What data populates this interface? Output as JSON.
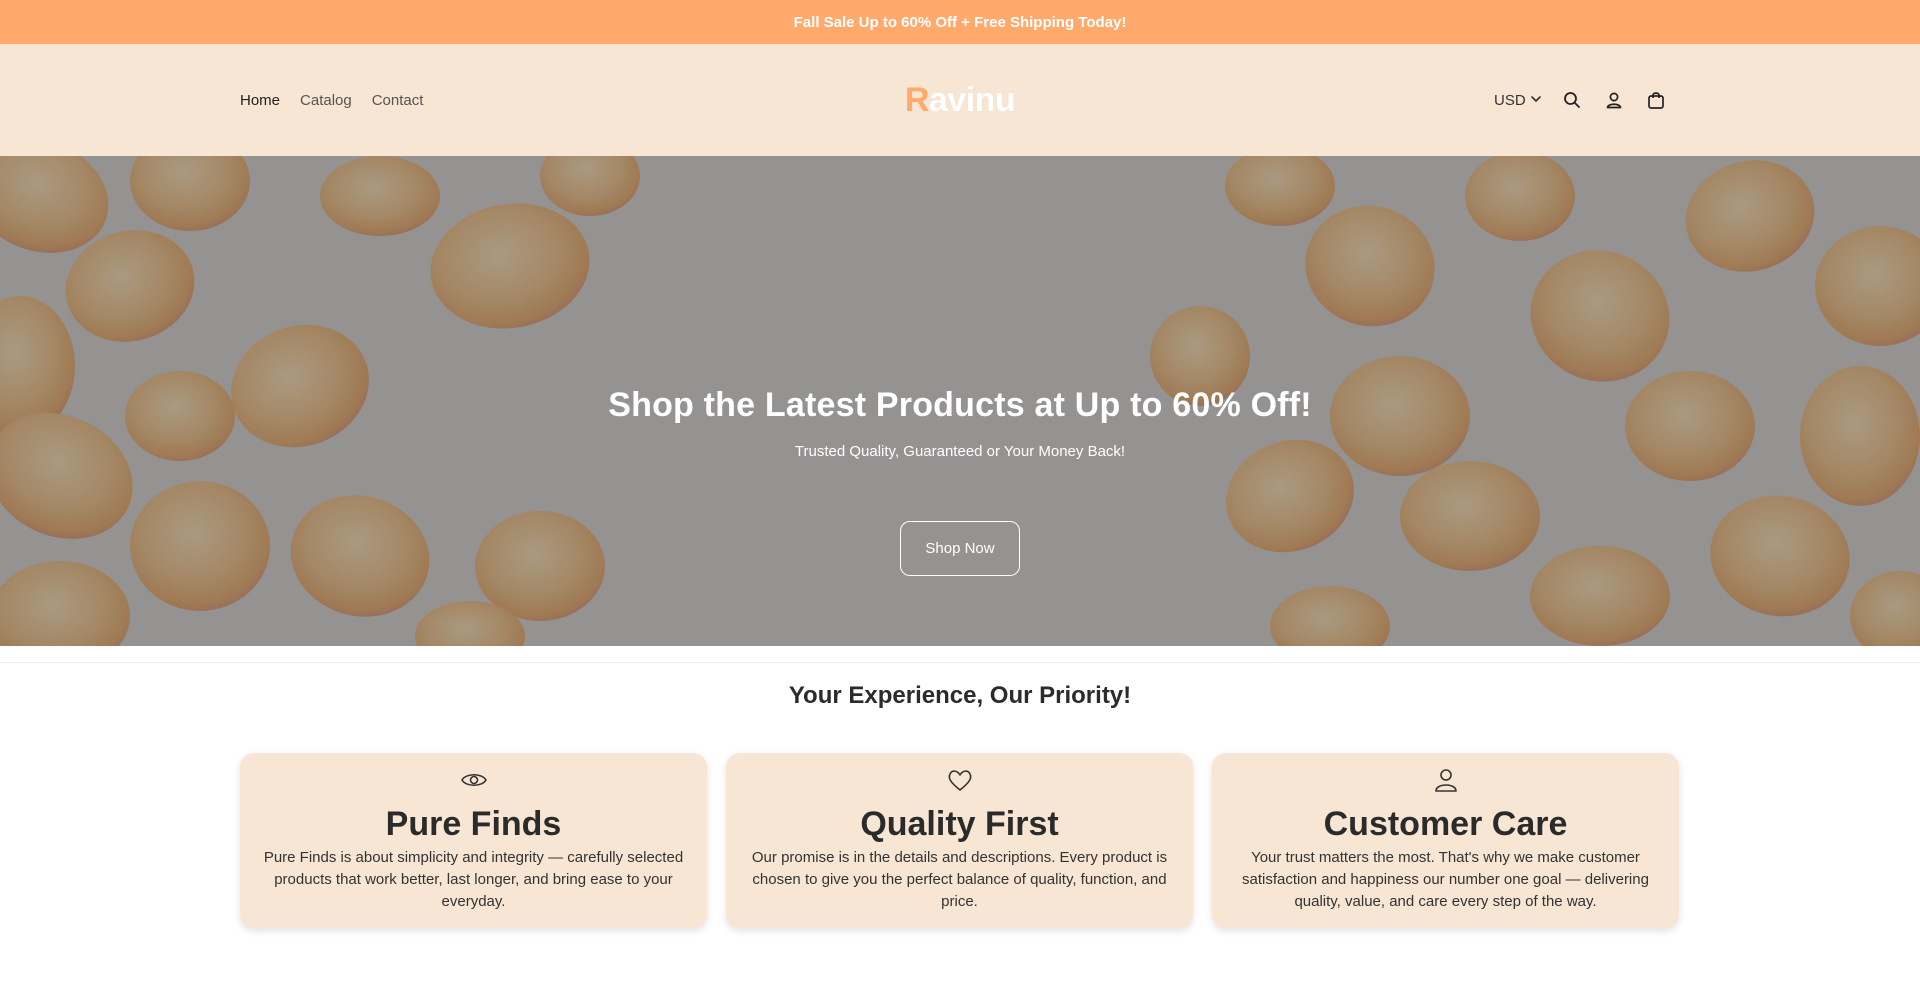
{
  "announcement": "Fall Sale Up to 60% Off + Free Shipping Today!",
  "nav": {
    "items": [
      "Home",
      "Catalog",
      "Contact"
    ]
  },
  "logo": {
    "first": "R",
    "rest": "avinu"
  },
  "tools": {
    "currency": "USD",
    "icons": [
      "chevron-down-icon",
      "search-icon",
      "account-icon",
      "cart-icon"
    ]
  },
  "hero": {
    "title": "Shop the Latest Products at Up to 60% Off!",
    "subtitle": "Trusted Quality, Guaranteed or Your Money Back!",
    "button": "Shop Now"
  },
  "features": {
    "title": "Your Experience, Our Priority!",
    "cards": [
      {
        "icon": "eye-icon",
        "title": "Pure Finds",
        "text": "Pure Finds is about simplicity and integrity — carefully selected products that work better, last longer, and bring ease to your everyday."
      },
      {
        "icon": "heart-icon",
        "title": "Quality First",
        "text": "Our promise is in the details and descriptions. Every product is chosen to give you the perfect balance of quality, function, and price."
      },
      {
        "icon": "user-icon",
        "title": "Customer Care",
        "text": "Your trust matters the most. That's why we make customer satisfaction and happiness our number one goal — delivering quality, value, and care every step of the way."
      }
    ]
  },
  "colors": {
    "announcement_bg": "#ffaa6c",
    "header_bg": "#f6e6d3",
    "card_bg": "#f6e6d3",
    "logo_accent": "#ffaa6c"
  }
}
